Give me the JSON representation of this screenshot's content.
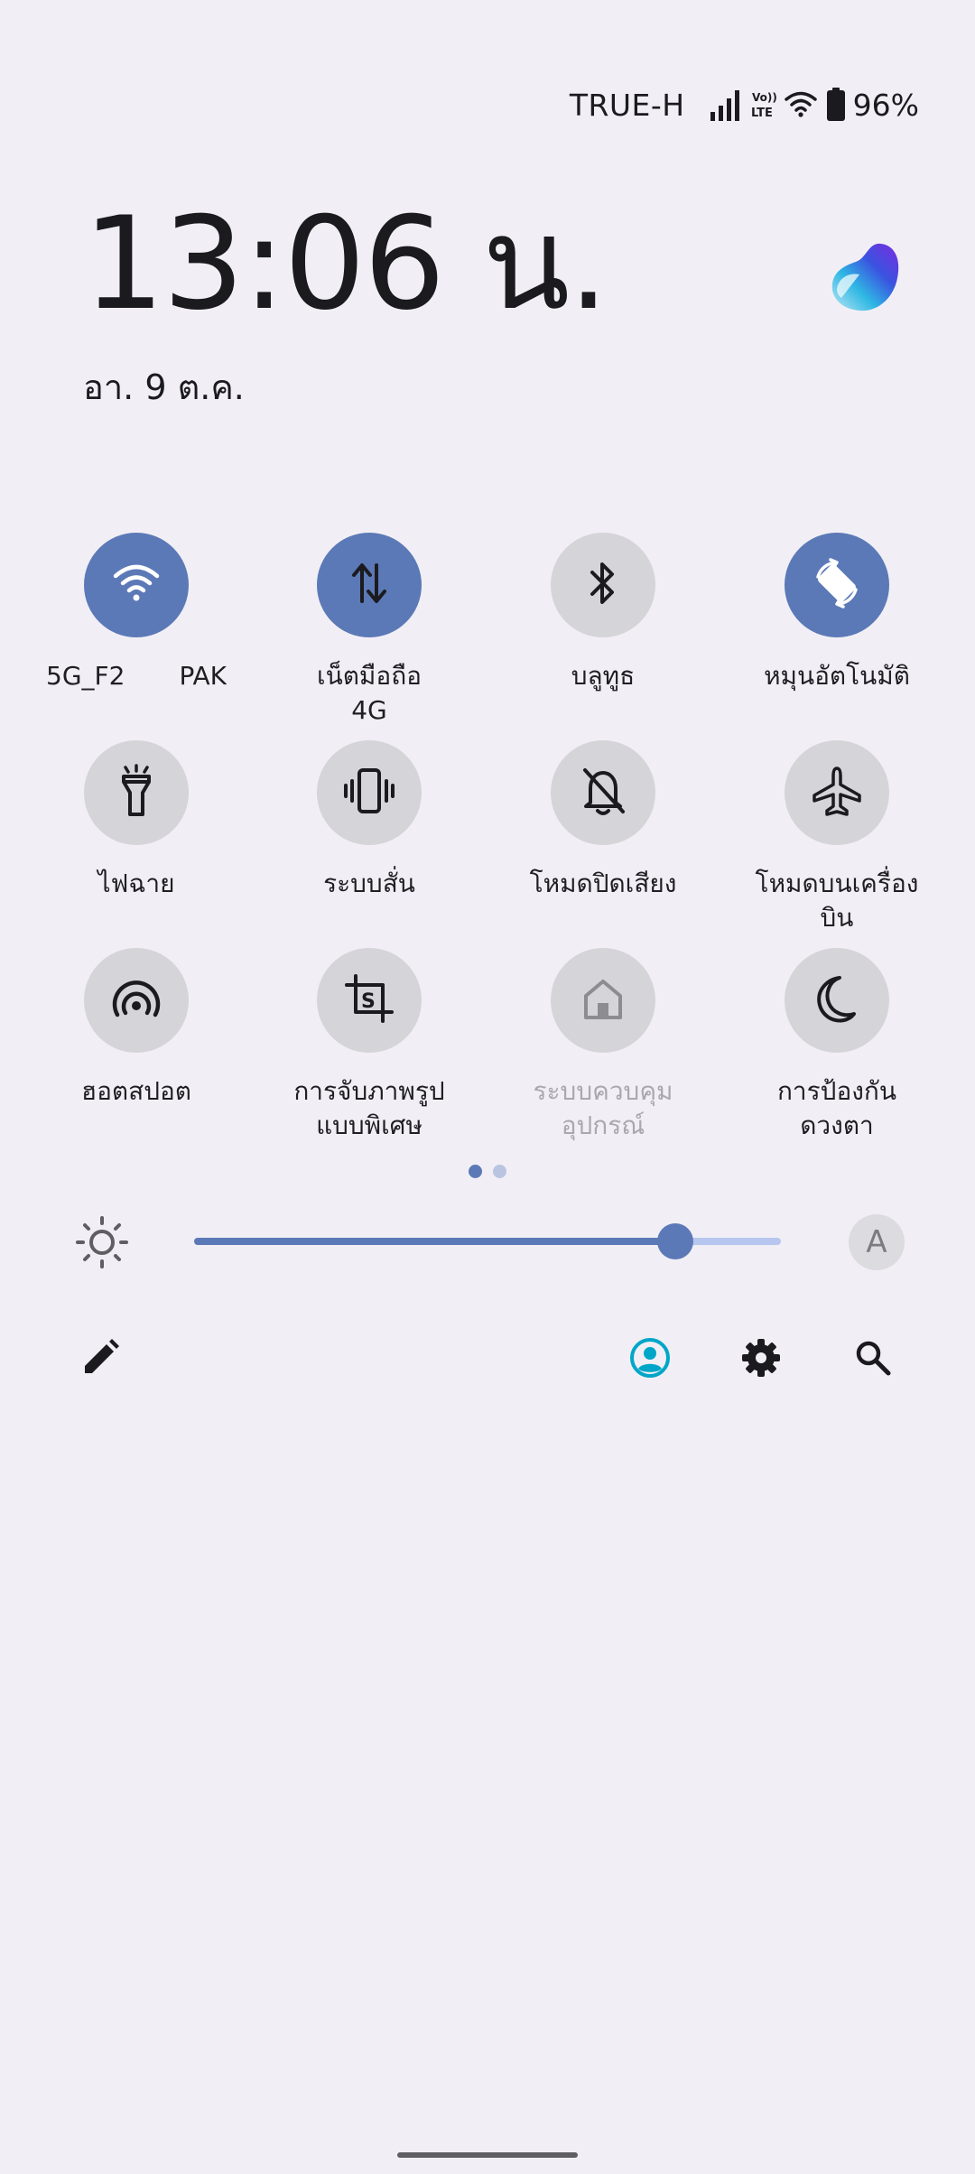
{
  "status_bar": {
    "carrier": "TRUE-H",
    "volte_label": "Vo)) LTE",
    "battery": "96%"
  },
  "clock": {
    "time": "13:06 น.",
    "date": "อา. 9 ต.ค."
  },
  "tiles": [
    {
      "label_a": "5G_F2",
      "label_b": "PAK",
      "state": "on",
      "icon": "wifi-icon"
    },
    {
      "label": "เน็ตมือถือ\n4G",
      "state": "on",
      "icon": "mobile-data-icon"
    },
    {
      "label": "บลูทูธ",
      "state": "off",
      "icon": "bluetooth-icon"
    },
    {
      "label": "หมุนอัตโนมัติ",
      "state": "on",
      "icon": "auto-rotate-icon"
    },
    {
      "label": "ไฟฉาย",
      "state": "off",
      "icon": "flashlight-icon"
    },
    {
      "label": "ระบบสั่น",
      "state": "off",
      "icon": "vibrate-icon"
    },
    {
      "label": "โหมดปิดเสียง",
      "state": "off",
      "icon": "mute-bell-icon"
    },
    {
      "label": "โหมดบนเครื่อง\nบิน",
      "state": "off",
      "icon": "airplane-icon"
    },
    {
      "label": "ฮอตสปอต",
      "state": "off",
      "icon": "hotspot-icon"
    },
    {
      "label": "การจับภาพรูป\nแบบพิเศษ",
      "state": "off",
      "icon": "screenshot-crop-icon"
    },
    {
      "label": "ระบบควบคุม\nอุปกรณ์",
      "state": "disabled",
      "icon": "home-control-icon"
    },
    {
      "label": "การป้องกัน\nดวงตา",
      "state": "off",
      "icon": "eye-comfort-moon-icon"
    }
  ],
  "pages": {
    "count": 2,
    "active": 0
  },
  "brightness": {
    "level": 0.82,
    "auto_label": "A"
  },
  "colors": {
    "accent": "#5c79b7",
    "tile_off": "#d5d4d9",
    "background": "#f1eff5",
    "profile": "#00a6c8"
  }
}
